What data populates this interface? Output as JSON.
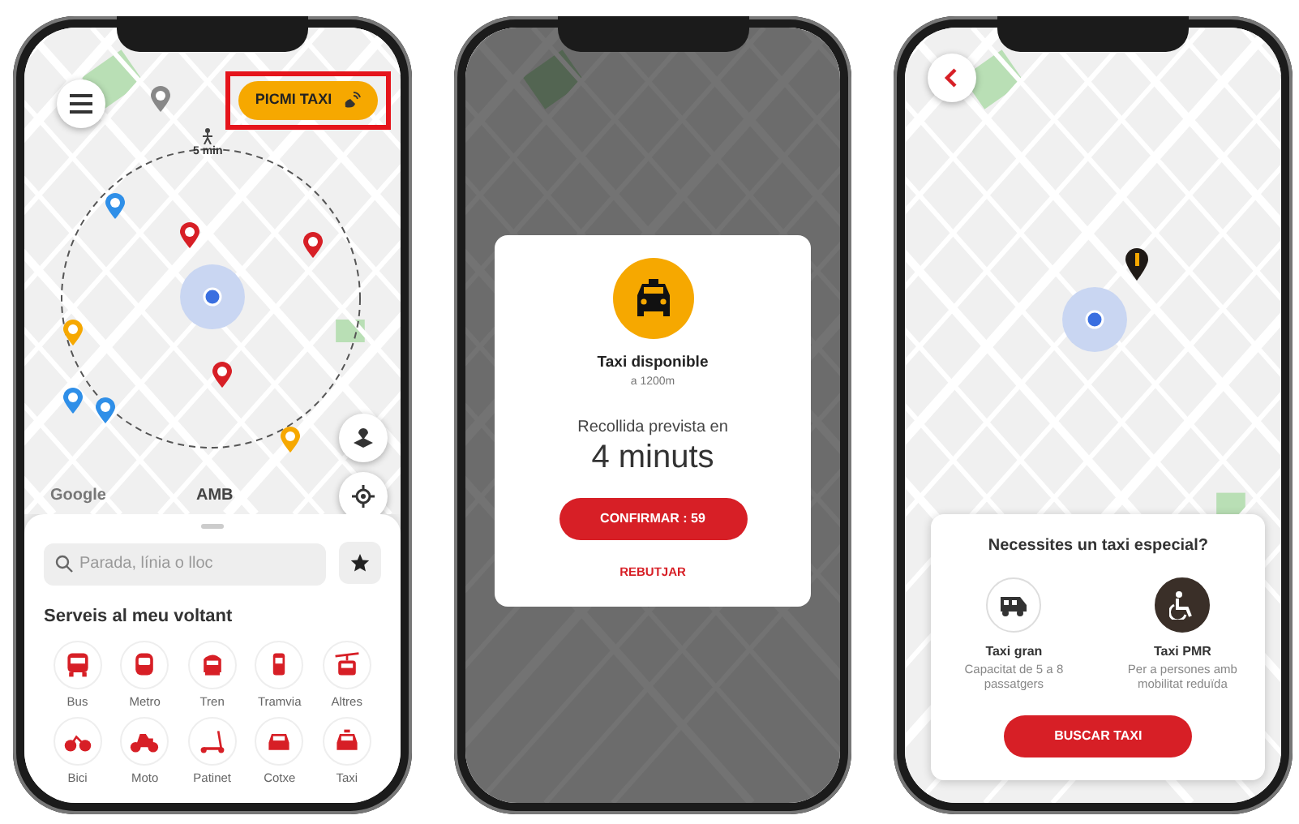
{
  "screen_map": {
    "taxi_button": {
      "label": "PICMI TAXI",
      "highlighted": true
    },
    "walk_time": "5 min",
    "map_credits": [
      "Google",
      "AMB"
    ],
    "search": {
      "placeholder": "Parada, línia o lloc"
    },
    "section_title": "Serveis al meu voltant",
    "services": [
      {
        "kind": "bus",
        "label": "Bus"
      },
      {
        "kind": "metro",
        "label": "Metro"
      },
      {
        "kind": "train",
        "label": "Tren"
      },
      {
        "kind": "tram",
        "label": "Tramvia"
      },
      {
        "kind": "cablecar",
        "label": "Altres"
      },
      {
        "kind": "bike",
        "label": "Bici"
      },
      {
        "kind": "moto",
        "label": "Moto"
      },
      {
        "kind": "scooter",
        "label": "Patinet"
      },
      {
        "kind": "car",
        "label": "Cotxe"
      },
      {
        "kind": "taxi",
        "label": "Taxi"
      }
    ]
  },
  "screen_offer": {
    "title": "Taxi disponible",
    "distance": "a 1200m",
    "pickup_label": "Recollida prevista en",
    "pickup_time": "4 minuts",
    "confirm_button": "CONFIRMAR : 59",
    "reject_button": "REBUTJAR"
  },
  "screen_special": {
    "title": "Necessites un taxi especial?",
    "options": [
      {
        "kind": "large",
        "name": "Taxi gran",
        "description": "Capacitat de 5 a 8 passatgers",
        "selected": false
      },
      {
        "kind": "pmr",
        "name": "Taxi PMR",
        "description": "Per a persones amb mobilitat reduïda",
        "selected": true
      }
    ],
    "search_button": "BUSCAR TAXI"
  }
}
